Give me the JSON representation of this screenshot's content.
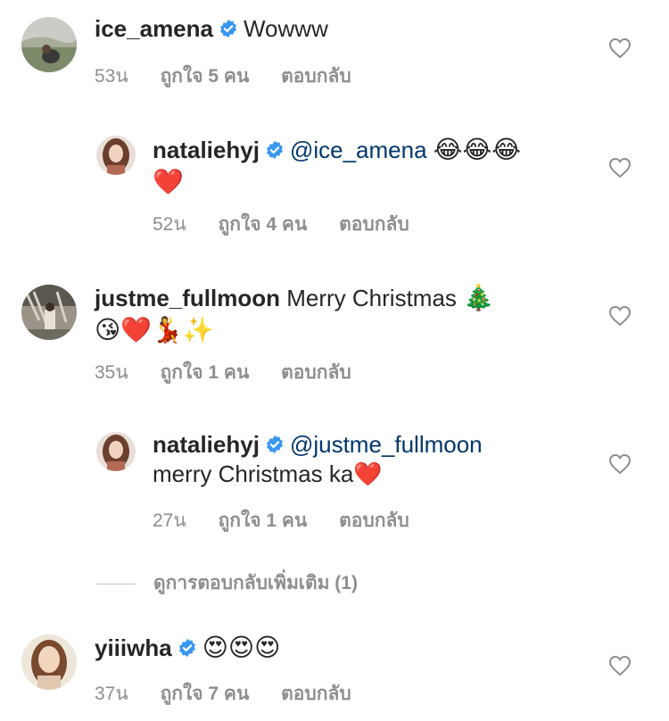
{
  "comments": [
    {
      "username": "ice_amena",
      "verified": true,
      "text": "Wowww",
      "time": "53น",
      "likes": "ถูกใจ 5 คน",
      "reply": "ตอบกลับ"
    },
    {
      "username": "nataliehyj",
      "verified": true,
      "mention": "@ice_amena",
      "emoji_inline": "😂😂😂",
      "text_line2": "❤️",
      "time": "52น",
      "likes": "ถูกใจ 4 คน",
      "reply": "ตอบกลับ"
    },
    {
      "username": "justme_fullmoon",
      "verified": false,
      "text": "Merry Christmas",
      "emoji_inline": "🎄",
      "text_line2": "😘❤️💃✨",
      "time": "35น",
      "likes": "ถูกใจ 1 คน",
      "reply": "ตอบกลับ"
    },
    {
      "username": "nataliehyj",
      "verified": true,
      "mention": "@justme_fullmoon",
      "text_line2": "merry Christmas ka❤️",
      "time": "27น",
      "likes": "ถูกใจ 1 คน",
      "reply": "ตอบกลับ"
    },
    {
      "username": "yiiiwha",
      "verified": true,
      "emoji_inline": "😍😍😍",
      "time": "37น",
      "likes": "ถูกใจ 7 คน",
      "reply": "ตอบกลับ"
    }
  ],
  "more_replies": "ดูการตอบกลับเพิ่มเติม (1)",
  "colors": {
    "verified_blue": "#3897f0",
    "mention": "#00376b",
    "meta_gray": "#8e8e8e"
  }
}
